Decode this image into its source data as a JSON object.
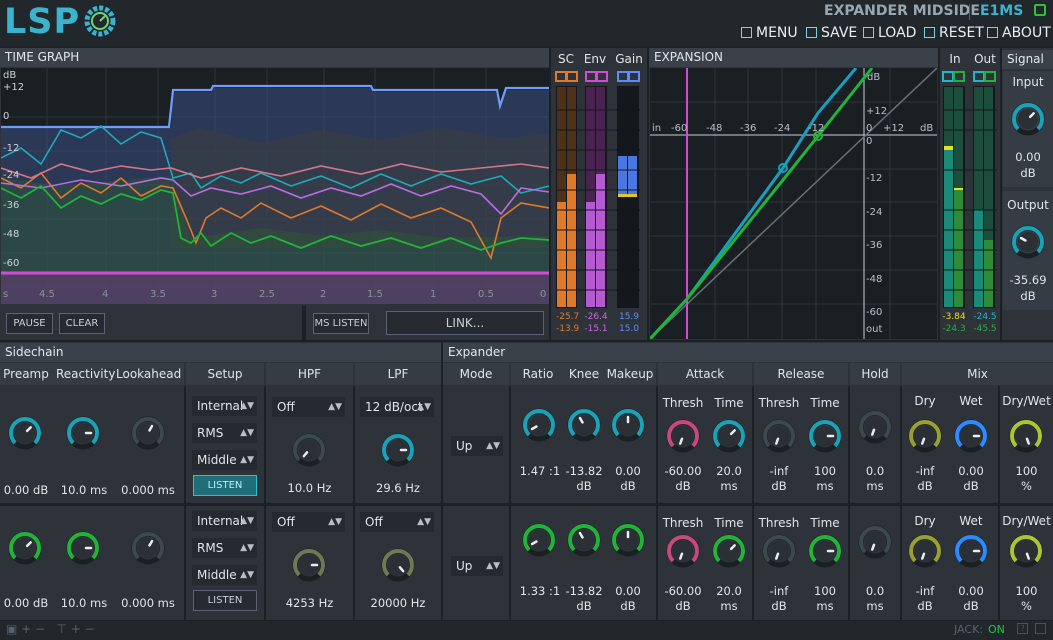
{
  "header": {
    "logo": "LSP",
    "plugin_name": "EXPANDER MIDSIDE",
    "plugin_short": "E1MS",
    "menu": [
      "MENU",
      "SAVE",
      "LOAD",
      "RESET",
      "ABOUT"
    ]
  },
  "time_graph": {
    "title": "TIME GRAPH",
    "y_labels": [
      "dB",
      "+12",
      "0",
      "-12",
      "-24",
      "-36",
      "-48",
      "-60"
    ],
    "x_labels": [
      "s",
      "4.5",
      "4",
      "3.5",
      "3",
      "2.5",
      "2",
      "1.5",
      "1",
      "0.5",
      "0"
    ],
    "buttons": {
      "pause": "PAUSE",
      "clear": "CLEAR",
      "ms_listen": "MS LISTEN",
      "link": "LINK..."
    }
  },
  "meters": {
    "sc": "SC",
    "env": "Env",
    "gain": "Gain",
    "sc_vals": [
      "-25.7",
      "-13.9"
    ],
    "env_vals": [
      "-26.4",
      "-15.1"
    ],
    "gain_vals": [
      "15.9",
      "15.0"
    ]
  },
  "expansion": {
    "title": "EXPANSION",
    "x_labels": [
      "in",
      "-60",
      "-48",
      "-36",
      "-24",
      "-12",
      "0",
      "+12",
      "dB"
    ],
    "y_labels": [
      "dB",
      "+12",
      "0",
      "-12",
      "-24",
      "-36",
      "-48",
      "-60",
      "out"
    ]
  },
  "io": {
    "in": "In",
    "out": "Out",
    "in_vals": [
      "-3.84",
      "-24.3"
    ],
    "out_vals": [
      "-24.5",
      "-45.5"
    ]
  },
  "signal": {
    "title": "Signal",
    "input_label": "Input",
    "input_value": "0.00",
    "input_unit": "dB",
    "output_label": "Output",
    "output_value": "-35.69",
    "output_unit": "dB"
  },
  "sidechain": {
    "title": "Sidechain",
    "cols": [
      "Preamp",
      "Reactivity",
      "Lookahead",
      "Setup",
      "HPF",
      "LPF"
    ],
    "rows": [
      {
        "preamp": "0.00 dB",
        "reactivity": "10.0 ms",
        "lookahead": "0.000 ms",
        "setup": [
          "Internal",
          "RMS",
          "Middle"
        ],
        "listen": "LISTEN",
        "hpf_mode": "Off",
        "hpf_val": "10.0 Hz",
        "lpf_mode": "12 dB/oct",
        "lpf_val": "29.6 Hz"
      },
      {
        "preamp": "0.00 dB",
        "reactivity": "10.0 ms",
        "lookahead": "0.000 ms",
        "setup": [
          "Internal",
          "RMS",
          "Middle"
        ],
        "listen": "LISTEN",
        "hpf_mode": "Off",
        "hpf_val": "4253 Hz",
        "lpf_mode": "Off",
        "lpf_val": "20000 Hz"
      }
    ]
  },
  "expander": {
    "title": "Expander",
    "cols": [
      "Mode",
      "Ratio",
      "Knee",
      "Makeup",
      "Attack",
      "Release",
      "Hold",
      "Mix"
    ],
    "sub": {
      "thresh": "Thresh",
      "time": "Time",
      "dry": "Dry",
      "wet": "Wet",
      "drywet": "Dry/Wet"
    },
    "rows": [
      {
        "mode": "Up",
        "ratio": "1.47 :1",
        "knee": "-13.82",
        "knee_u": "dB",
        "makeup": "0.00",
        "makeup_u": "dB",
        "att_th": "-60.00",
        "att_th_u": "dB",
        "att_t": "20.0",
        "att_t_u": "ms",
        "rel_th": "-inf",
        "rel_th_u": "dB",
        "rel_t": "100",
        "rel_t_u": "ms",
        "hold": "0.0",
        "hold_u": "ms",
        "dry": "-inf",
        "dry_u": "dB",
        "wet": "0.00",
        "wet_u": "dB",
        "dw": "100",
        "dw_u": "%"
      },
      {
        "mode": "Up",
        "ratio": "1.33 :1",
        "knee": "-13.82",
        "knee_u": "dB",
        "makeup": "0.00",
        "makeup_u": "dB",
        "att_th": "-60.00",
        "att_th_u": "dB",
        "att_t": "20.0",
        "att_t_u": "ms",
        "rel_th": "-inf",
        "rel_th_u": "dB",
        "rel_t": "100",
        "rel_t_u": "ms",
        "hold": "0.0",
        "hold_u": "ms",
        "dry": "-inf",
        "dry_u": "dB",
        "wet": "0.00",
        "wet_u": "dB",
        "dw": "100",
        "dw_u": "%"
      }
    ]
  },
  "footer": {
    "jack": "JACK:",
    "jack_state": "ON"
  },
  "colors": {
    "accent": "#2aa3b8",
    "green": "#21b33a",
    "magenta": "#d24bd8",
    "blue": "#5c8cff",
    "orange": "#e07a2a"
  }
}
